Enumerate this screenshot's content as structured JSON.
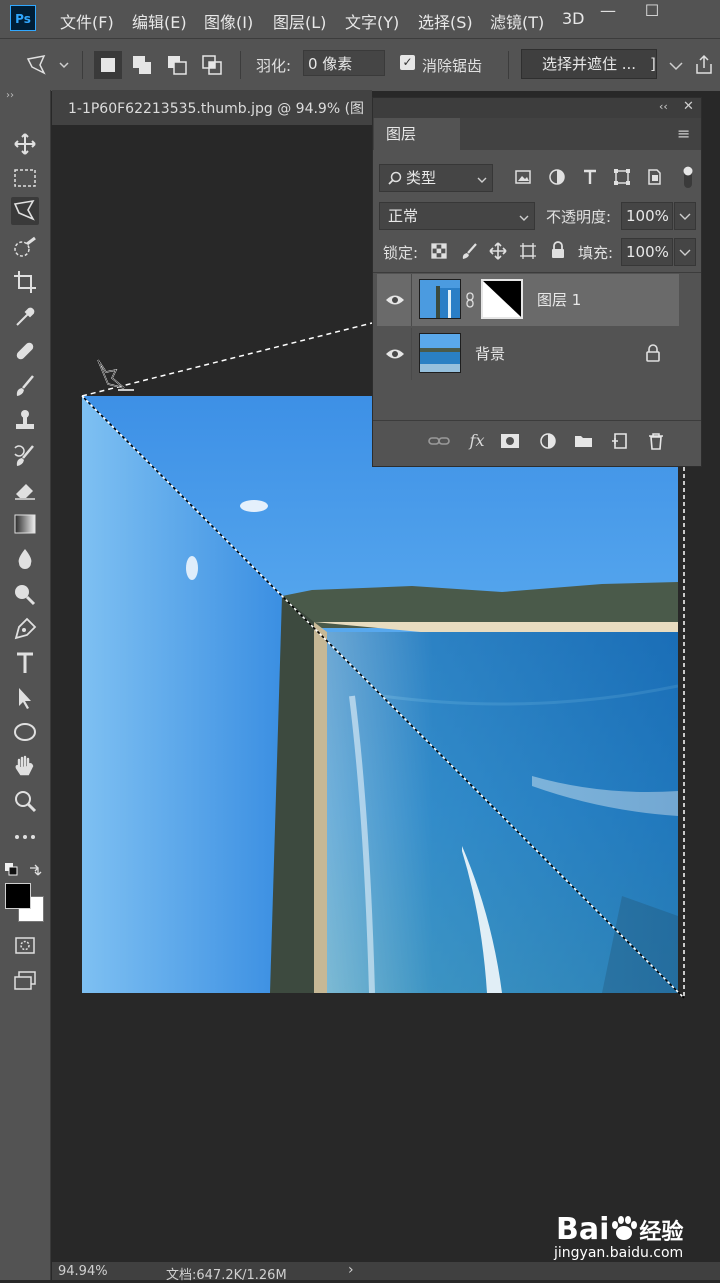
{
  "app": {
    "logo": "Ps"
  },
  "menu": [
    "文件(F)",
    "编辑(E)",
    "图像(I)",
    "图层(L)",
    "文字(Y)",
    "选择(S)",
    "滤镜(T)",
    "3D"
  ],
  "window_buttons": {
    "minimize": "—",
    "maximize": "☐"
  },
  "options_bar": {
    "feather_label": "羽化:",
    "feather_value": "0 像素",
    "antialias_label": "消除锯齿",
    "antialias_checked": "✓",
    "select_mask_button": "选择并遮住 ...",
    "bracket": "]"
  },
  "document": {
    "tab_title": "1-1P60F62213535.thumb.jpg @ 94.9% (图"
  },
  "status_bar": {
    "zoom": "94.94%",
    "doc_info": "文档:647.2K/1.26M",
    "arrow": "›"
  },
  "layers_panel": {
    "collapse": "‹‹",
    "close": "✕",
    "tab": "图层",
    "menu": "≡",
    "filter_kind": "类型",
    "blend_mode": "正常",
    "opacity_label": "不透明度:",
    "opacity_value": "100%",
    "lock_label": "锁定:",
    "fill_label": "填充:",
    "fill_value": "100%",
    "layers": [
      {
        "name": "图层 1"
      },
      {
        "name": "背景"
      }
    ]
  },
  "watermark": {
    "brand": "Bai",
    "brand2": "经验",
    "url": "jingyan.baidu.com"
  }
}
